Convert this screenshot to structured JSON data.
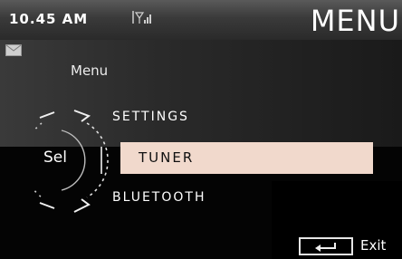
{
  "status": {
    "time": "10.45 AM"
  },
  "title": "MENU",
  "breadcrumb": "Menu",
  "selector": {
    "label": "Sel"
  },
  "menu": {
    "items": [
      {
        "label": "SETTINGS"
      },
      {
        "label": "TUNER",
        "selected": true
      },
      {
        "label": "BLUETOOTH"
      }
    ]
  },
  "footer": {
    "exit_label": "Exit"
  },
  "icons": [
    "signal-icon",
    "mail-icon",
    "rotary-knob-icon",
    "enter-arrow-icon"
  ],
  "colors": {
    "highlight": "#f1d9cc",
    "background": "#040404",
    "text": "#ffffff"
  }
}
